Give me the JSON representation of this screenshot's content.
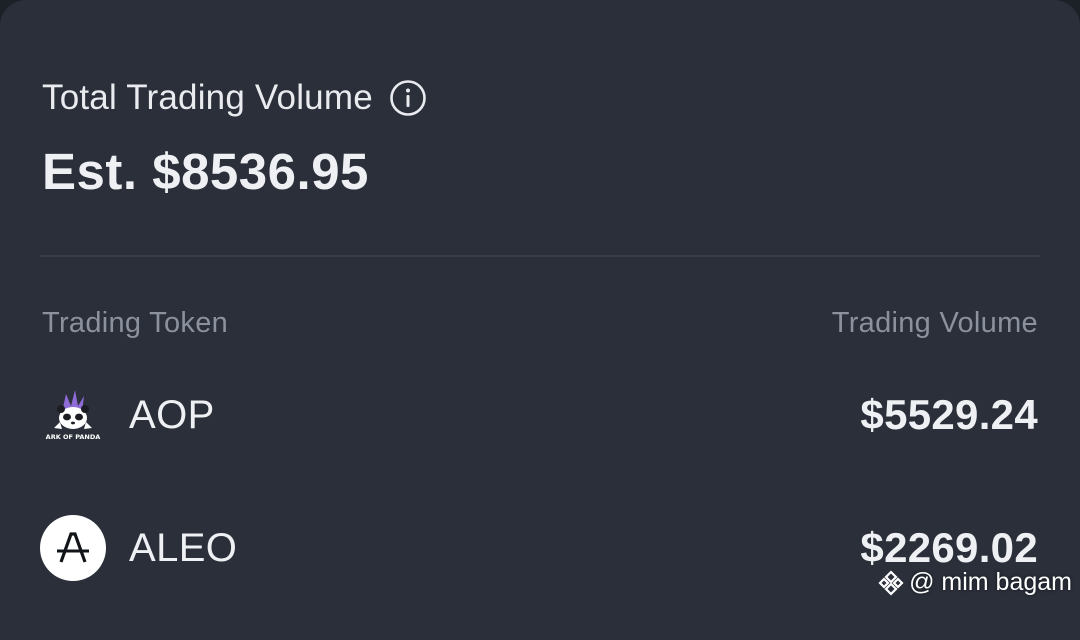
{
  "header": {
    "title": "Total Trading Volume",
    "info_icon": "info-circle-icon",
    "estimate": "Est. $8536.95"
  },
  "table": {
    "columns": [
      "Trading Token",
      "Trading Volume"
    ],
    "rows": [
      {
        "token": "AOP",
        "volume": "$5529.24",
        "icon": "ark-of-panda-logo",
        "icon_text": "ARK OF PANDA"
      },
      {
        "token": "ALEO",
        "volume": "$2269.02",
        "icon": "aleo-logo"
      }
    ]
  },
  "watermark": {
    "text": "@ mim bagam",
    "logo": "binance-logo"
  },
  "colors": {
    "card_bg": "#2a2f3a",
    "text_primary": "#eef0f3",
    "text_secondary": "#8b919d",
    "divider": "#363c48",
    "aop_accent": "#8f6bd8"
  }
}
